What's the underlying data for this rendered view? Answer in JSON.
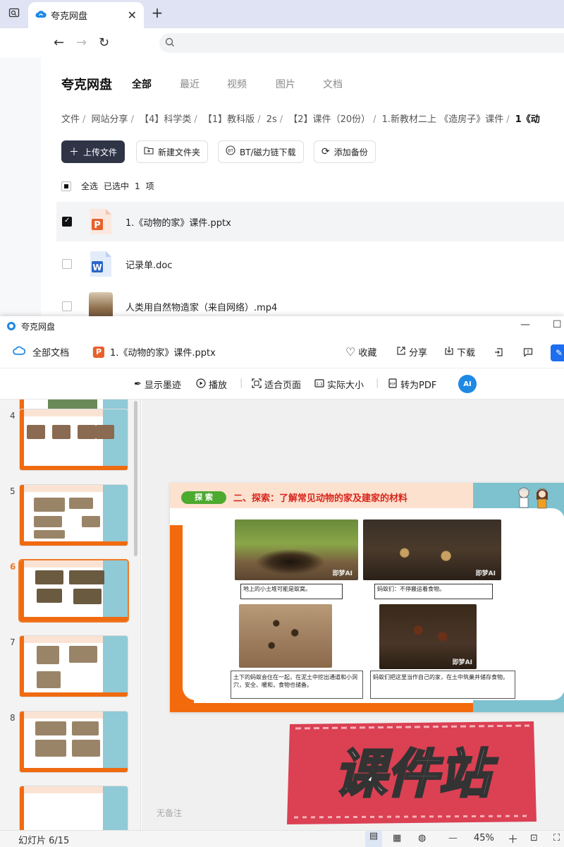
{
  "browser": {
    "tab_title": "夸克网盘",
    "tab_close": "✕",
    "new_tab": "+",
    "back": "←",
    "forward": "→",
    "reload": "↻",
    "search_placeholder": ""
  },
  "cloud": {
    "brand": "夸克网盘",
    "nav": [
      "全部",
      "最近",
      "视频",
      "图片",
      "文档"
    ],
    "breadcrumb": [
      "文件",
      "网站分享",
      "【4】科学类",
      "【1】教科版",
      "2s",
      "【2】课件（20份）",
      "1.新教材二上 《造房子》课件"
    ],
    "breadcrumb_current": "1《动",
    "buttons": {
      "upload": "上传文件",
      "new_folder": "新建文件夹",
      "bt": "BT/磁力链下载",
      "backup": "添加备份"
    },
    "selection": {
      "select_all": "全选",
      "selected": "已选中",
      "count": "1",
      "unit": "项"
    },
    "files": [
      {
        "name": "1.《动物的家》课件.pptx",
        "type": "pptx",
        "selected": true
      },
      {
        "name": "记录单.doc",
        "type": "doc",
        "selected": false
      },
      {
        "name": "人类用自然物造家（来自网络）.mp4",
        "type": "mp4",
        "selected": false
      }
    ]
  },
  "viewer": {
    "window_title": "夸克网盘",
    "all_docs": "全部文档",
    "doc_name": "1.《动物的家》课件.pptx",
    "actions": {
      "fav": "收藏",
      "share": "分享",
      "download": "下载"
    },
    "toolbar": {
      "ink": "显示墨迹",
      "play": "播放",
      "fit": "适合页面",
      "actual": "实际大小",
      "to_pdf": "转为PDF"
    },
    "thumbnail_numbers": [
      "4",
      "5",
      "6",
      "7",
      "8"
    ],
    "slide": {
      "tag": "探 索",
      "heading": "二、探索：了解常见动物的家及建家的材料",
      "ai_mark": "即梦AI",
      "cap1": "地上的小土堆可能是蚁窝。",
      "cap2": "蚂蚁们：不停搬运着食物。",
      "cap3": "土下的蚂蚁会住在一起，在泥土中挖出通道和小洞穴，安全、暖和，食物也储备。",
      "cap4": "蚂蚁们把这里当作自己的家，在土中筑巢并储存食物。"
    },
    "stamp_text": "课件站",
    "no_notes": "无备注",
    "status": {
      "slide_indicator": "幻灯片 6/15",
      "zoom": "45%"
    }
  },
  "colors": {
    "orange": "#f26a0c",
    "teal": "#7ec2cf",
    "red": "#d8261c",
    "green_tag": "#4caa2f",
    "stamp_red": "#d9364a"
  }
}
